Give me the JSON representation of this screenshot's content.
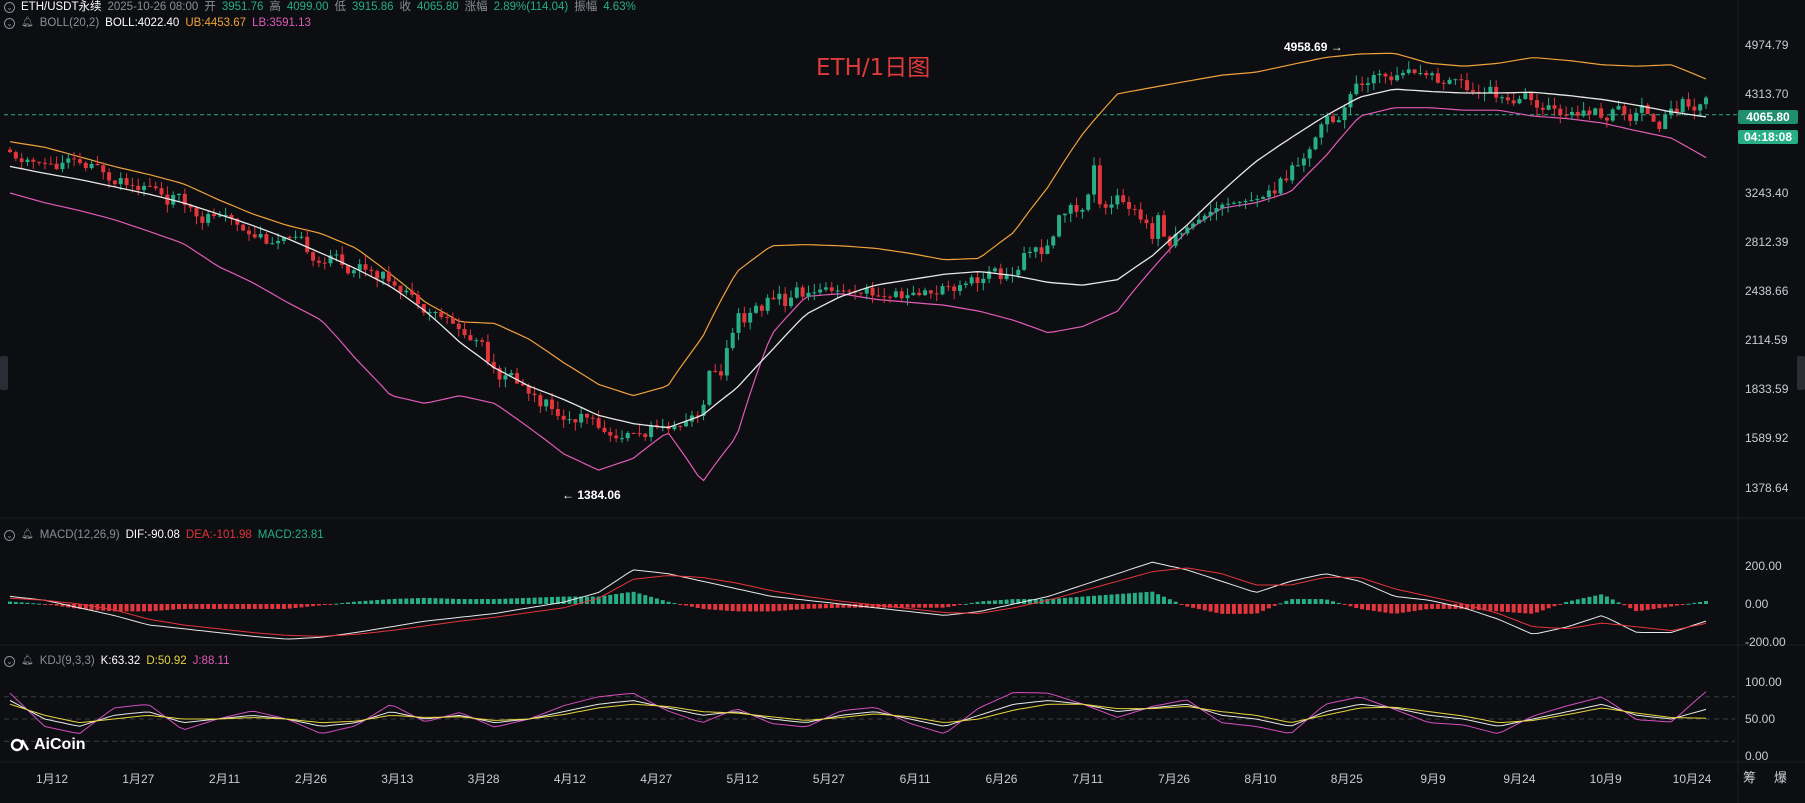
{
  "header": {
    "symbol": "ETH/USDT永续",
    "date": "2025-10-26 08:00",
    "open_label": "开",
    "open": "3951.76",
    "high_label": "高",
    "high": "4099.00",
    "low_label": "低",
    "low": "3915.86",
    "close_label": "收",
    "close": "4065.80",
    "change_label": "涨幅",
    "change": "2.89%(114.04)",
    "amp_label": "振幅",
    "amp": "4.63%"
  },
  "boll": {
    "name": "BOLL(20,2)",
    "boll": "BOLL:4022.40",
    "ub": "UB:4453.67",
    "lb": "LB:3591.13"
  },
  "macd": {
    "name": "MACD(12,26,9)",
    "dif": "DIF:-90.08",
    "dea": "DEA:-101.98",
    "macd": "MACD:23.81"
  },
  "kdj": {
    "name": "KDJ(9,3,3)",
    "k": "K:63.32",
    "d": "D:50.92",
    "j": "J:88.11"
  },
  "title": "ETH/1日图",
  "logo": "AiCoin",
  "current_price_tag": "4065.80",
  "countdown_tag": "04:18:08",
  "high_annotation": "4958.69",
  "low_annotation": "1384.06",
  "bottom_buttons": [
    "筹",
    "爆"
  ],
  "colors": {
    "up": "#27ae87",
    "down": "#e2353c",
    "mid": "#e8e8e8",
    "ub": "#f0a23b",
    "lb": "#e05bb8"
  },
  "chart_data": {
    "type": "candlestick",
    "price_axis": [
      "4974.79",
      "4313.70",
      "3243.40",
      "2812.39",
      "2438.66",
      "2114.59",
      "1833.59",
      "1589.92",
      "1378.64"
    ],
    "macd_axis": [
      "200.00",
      "0.00",
      "-200.00"
    ],
    "kdj_axis": [
      "100.00",
      "50.00",
      "0.00"
    ],
    "x_labels": [
      "1月12",
      "1月27",
      "2月11",
      "2月26",
      "3月13",
      "3月28",
      "4月12",
      "4月27",
      "5月12",
      "5月27",
      "6月11",
      "6月26",
      "7月11",
      "7月26",
      "8月10",
      "8月25",
      "9月9",
      "9月24",
      "10月9",
      "10月24"
    ],
    "mid_series": [
      3500,
      3430,
      3370,
      3300,
      3230,
      3150,
      3050,
      2950,
      2840,
      2720,
      2600,
      2470,
      2300,
      2100,
      1950,
      1850,
      1780,
      1700,
      1660,
      1640,
      1700,
      1840,
      2050,
      2280,
      2400,
      2480,
      2520,
      2560,
      2580,
      2550,
      2500,
      2480,
      2520,
      2700,
      2950,
      3250,
      3550,
      3800,
      4050,
      4280,
      4380,
      4350,
      4330,
      4330,
      4340,
      4300,
      4250,
      4180,
      4100,
      4040
    ],
    "ub_series": [
      3760,
      3700,
      3600,
      3500,
      3420,
      3330,
      3180,
      3050,
      2950,
      2880,
      2760,
      2560,
      2360,
      2230,
      2220,
      2120,
      1980,
      1860,
      1800,
      1850,
      2130,
      2580,
      2780,
      2790,
      2780,
      2760,
      2720,
      2670,
      2680,
      2890,
      3300,
      3850,
      4320,
      4400,
      4480,
      4560,
      4600,
      4700,
      4800,
      4850,
      4860,
      4720,
      4680,
      4720,
      4800,
      4760,
      4700,
      4680,
      4700,
      4510
    ],
    "lb_series": [
      3240,
      3150,
      3080,
      3000,
      2900,
      2800,
      2620,
      2500,
      2360,
      2240,
      2000,
      1800,
      1760,
      1800,
      1760,
      1640,
      1520,
      1450,
      1500,
      1620,
      1400,
      1600,
      2150,
      2400,
      2420,
      2380,
      2360,
      2340,
      2300,
      2240,
      2160,
      2200,
      2300,
      2600,
      2900,
      3100,
      3150,
      3250,
      3600,
      4050,
      4150,
      4150,
      4120,
      4120,
      4050,
      4020,
      3970,
      3880,
      3800,
      3590
    ],
    "macd_dif": [
      40,
      20,
      -20,
      -60,
      -110,
      -130,
      -150,
      -170,
      -185,
      -175,
      -150,
      -120,
      -90,
      -70,
      -50,
      -20,
      10,
      60,
      180,
      160,
      120,
      80,
      40,
      20,
      0,
      -20,
      -40,
      -60,
      -40,
      0,
      40,
      100,
      160,
      220,
      180,
      120,
      60,
      120,
      160,
      120,
      40,
      20,
      -20,
      -80,
      -160,
      -120,
      -60,
      -150,
      -150,
      -90
    ],
    "macd_dea": [
      30,
      20,
      0,
      -30,
      -80,
      -110,
      -130,
      -150,
      -165,
      -170,
      -160,
      -140,
      -115,
      -90,
      -70,
      -45,
      -20,
      30,
      130,
      150,
      140,
      110,
      70,
      40,
      15,
      -5,
      -25,
      -45,
      -50,
      -20,
      20,
      70,
      120,
      170,
      190,
      160,
      100,
      100,
      140,
      140,
      80,
      40,
      0,
      -50,
      -120,
      -130,
      -100,
      -120,
      -140,
      -102
    ],
    "kdj_k": [
      75,
      50,
      40,
      55,
      60,
      45,
      50,
      55,
      50,
      40,
      45,
      60,
      50,
      55,
      45,
      50,
      60,
      70,
      75,
      65,
      55,
      60,
      50,
      45,
      55,
      60,
      50,
      40,
      55,
      70,
      75,
      70,
      60,
      65,
      70,
      55,
      50,
      40,
      60,
      70,
      65,
      55,
      50,
      40,
      50,
      60,
      70,
      55,
      50,
      63
    ],
    "kdj_d": [
      70,
      55,
      45,
      50,
      55,
      50,
      50,
      52,
      50,
      45,
      47,
      55,
      52,
      53,
      48,
      50,
      56,
      65,
      70,
      67,
      60,
      58,
      53,
      48,
      52,
      57,
      53,
      45,
      50,
      62,
      70,
      70,
      64,
      64,
      67,
      60,
      55,
      45,
      55,
      65,
      66,
      60,
      54,
      45,
      48,
      56,
      65,
      58,
      52,
      51
    ]
  }
}
